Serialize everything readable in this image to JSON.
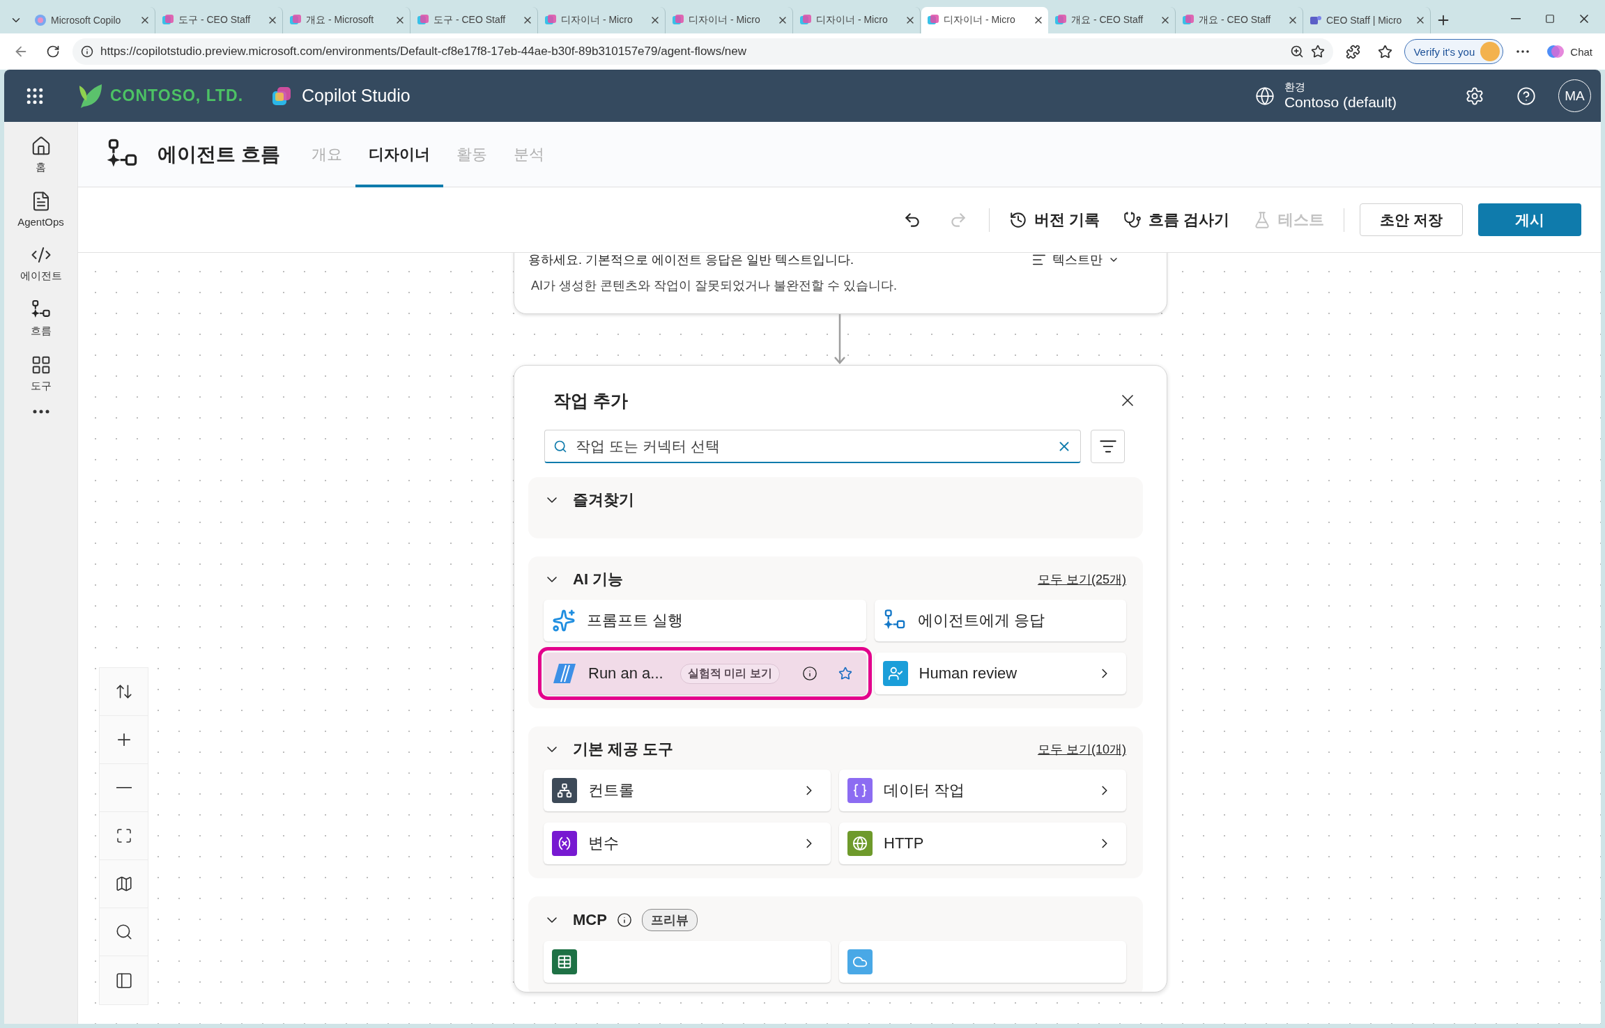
{
  "browser": {
    "tabs": [
      {
        "title": "Microsoft Copilo",
        "selected": false
      },
      {
        "title": "도구 - CEO Staff",
        "selected": false
      },
      {
        "title": "개요 - Microsoft",
        "selected": false
      },
      {
        "title": "도구 - CEO Staff",
        "selected": false
      },
      {
        "title": "디자이너 - Micro",
        "selected": false
      },
      {
        "title": "디자이너 - Micro",
        "selected": false
      },
      {
        "title": "디자이너 - Micro",
        "selected": false
      },
      {
        "title": "디자이너 - Micro",
        "selected": true
      },
      {
        "title": "개요 - CEO Staff",
        "selected": false
      },
      {
        "title": "개요 - CEO Staff",
        "selected": false
      },
      {
        "title": "CEO Staff | Micro",
        "selected": false
      }
    ],
    "address": "https://copilotstudio.preview.microsoft.com/environments/Default-cf8e17f8-17eb-44ae-b30f-89b310157e79/agent-flows/new",
    "verify": "Verify it's you",
    "chat": "Chat"
  },
  "header": {
    "company": "CONTOSO, LTD.",
    "product": "Copilot Studio",
    "environment_label": "환경",
    "environment": "Contoso (default)",
    "avatar": "MA"
  },
  "rail": [
    {
      "label": "홈",
      "kind": "home"
    },
    {
      "label": "AgentOps",
      "kind": "agentops"
    },
    {
      "label": "에이전트",
      "kind": "agent"
    },
    {
      "label": "흐름",
      "kind": "flow"
    },
    {
      "label": "도구",
      "kind": "tools"
    },
    {
      "kind": "more"
    }
  ],
  "page": {
    "title": "에이전트 흐름",
    "tabs": [
      {
        "label": "개요",
        "selected": false
      },
      {
        "label": "디자이너",
        "selected": true
      },
      {
        "label": "활동",
        "selected": false
      },
      {
        "label": "분석",
        "selected": false
      }
    ]
  },
  "toolbar": [
    {
      "kind": "undo",
      "disabled": false
    },
    {
      "kind": "redo",
      "disabled": true
    },
    {
      "kind": "divider"
    },
    {
      "kind": "history",
      "label": "버전 기록",
      "disabled": false
    },
    {
      "kind": "checker",
      "label": "흐름 검사기",
      "disabled": false
    },
    {
      "kind": "test",
      "label": "테스트",
      "disabled": true
    },
    {
      "kind": "divider"
    },
    {
      "kind": "save",
      "label": "초안 저장",
      "disabled": false
    },
    {
      "kind": "publish",
      "label": "게시",
      "disabled": false
    }
  ],
  "node": {
    "text": "용하세요. 기본적으로 에이전트 응답은 일반 텍스트입니다.",
    "format": "텍스트만",
    "disclaimer": "AI가 생성한 콘텐츠와 작업이 잘못되었거나 불완전할 수 있습니다."
  },
  "panel": {
    "title": "작업 추가",
    "search": {
      "placeholder": "작업 또는 커넥터 선택"
    },
    "sections": [
      {
        "title": "즐겨찾기",
        "expanded": true
      },
      {
        "title": "AI 기능",
        "expanded": true,
        "link": "모두 보기(25개)",
        "items": [
          {
            "label": "프롬프트 실행",
            "kind": "prompt",
            "chevron": false,
            "selected": false
          },
          {
            "label": "에이전트에게 응답",
            "kind": "agent",
            "chevron": false,
            "selected": false
          },
          {
            "label": "Run an a...",
            "kind": "run",
            "badge": "실험적 미리 보기",
            "info": true,
            "favorite": false,
            "chevron": false,
            "selected": true
          },
          {
            "label": "Human review",
            "kind": "human",
            "chevron": true,
            "selected": false
          }
        ]
      },
      {
        "title": "기본 제공 도구",
        "expanded": true,
        "link": "모두 보기(10개)",
        "items": [
          {
            "label": "컨트롤",
            "kind": "control",
            "chevron": true,
            "selected": false
          },
          {
            "label": "데이터 작업",
            "kind": "data",
            "chevron": true,
            "selected": false
          },
          {
            "label": "변수",
            "kind": "variable",
            "chevron": true,
            "selected": false
          },
          {
            "label": "HTTP",
            "kind": "http",
            "chevron": true,
            "selected": false
          }
        ]
      },
      {
        "title": "MCP",
        "expanded": true,
        "info": true,
        "badge": "프리뷰",
        "items": [
          {
            "kind": "sheet",
            "selected": false
          },
          {
            "kind": "cloud",
            "selected": false
          }
        ]
      }
    ]
  }
}
